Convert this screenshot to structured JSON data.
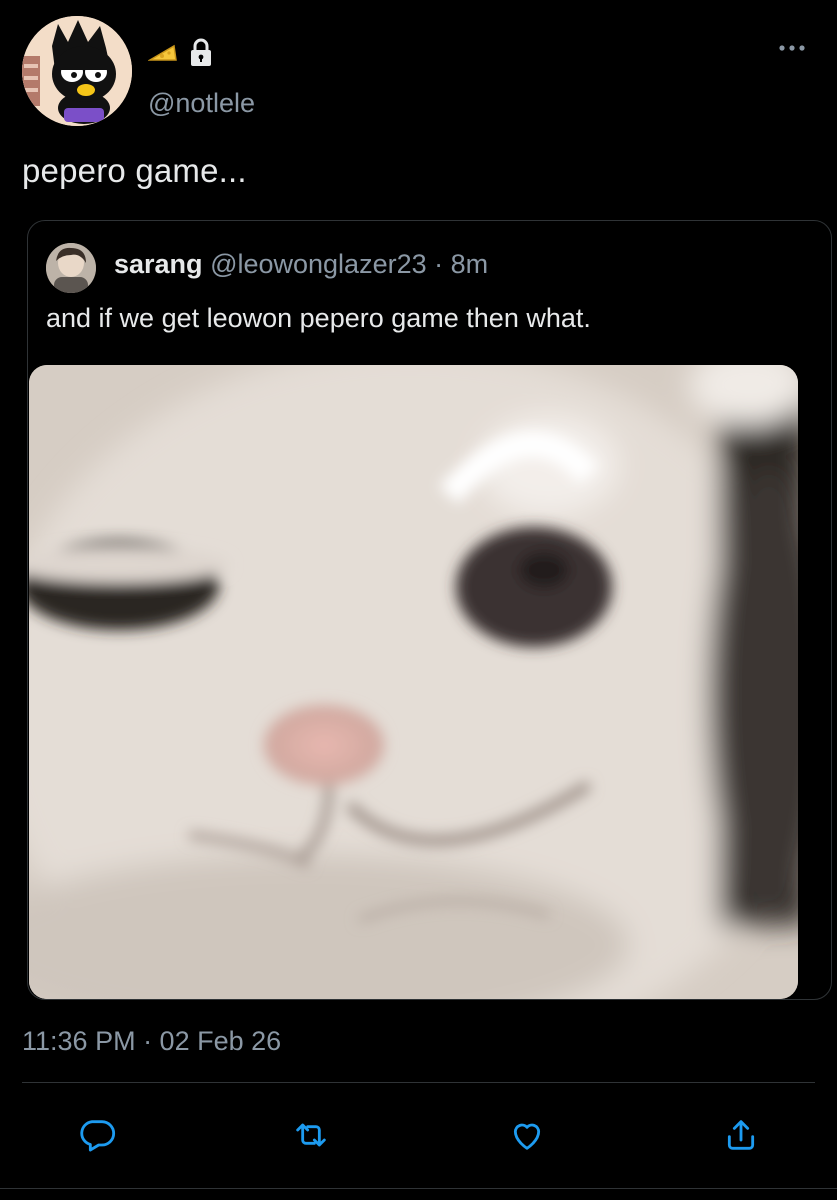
{
  "author": {
    "handle": "@notlele",
    "badges": [
      "cheese-emoji",
      "lock-icon"
    ]
  },
  "tweet": {
    "text": "pepero game...",
    "timestamp": "11:36 PM · 02 Feb 26"
  },
  "quoted_tweet": {
    "name": "sarang",
    "meta": "@leowonglazer23 · 8m",
    "text": "and if we get leowon pepero game then what."
  },
  "actions": [
    "reply-icon",
    "retweet-icon",
    "like-icon",
    "share-icon"
  ],
  "colors": {
    "background": "#000000",
    "text": "#e7e9ea",
    "secondary": "#8b98a5",
    "border": "#2f3336"
  }
}
